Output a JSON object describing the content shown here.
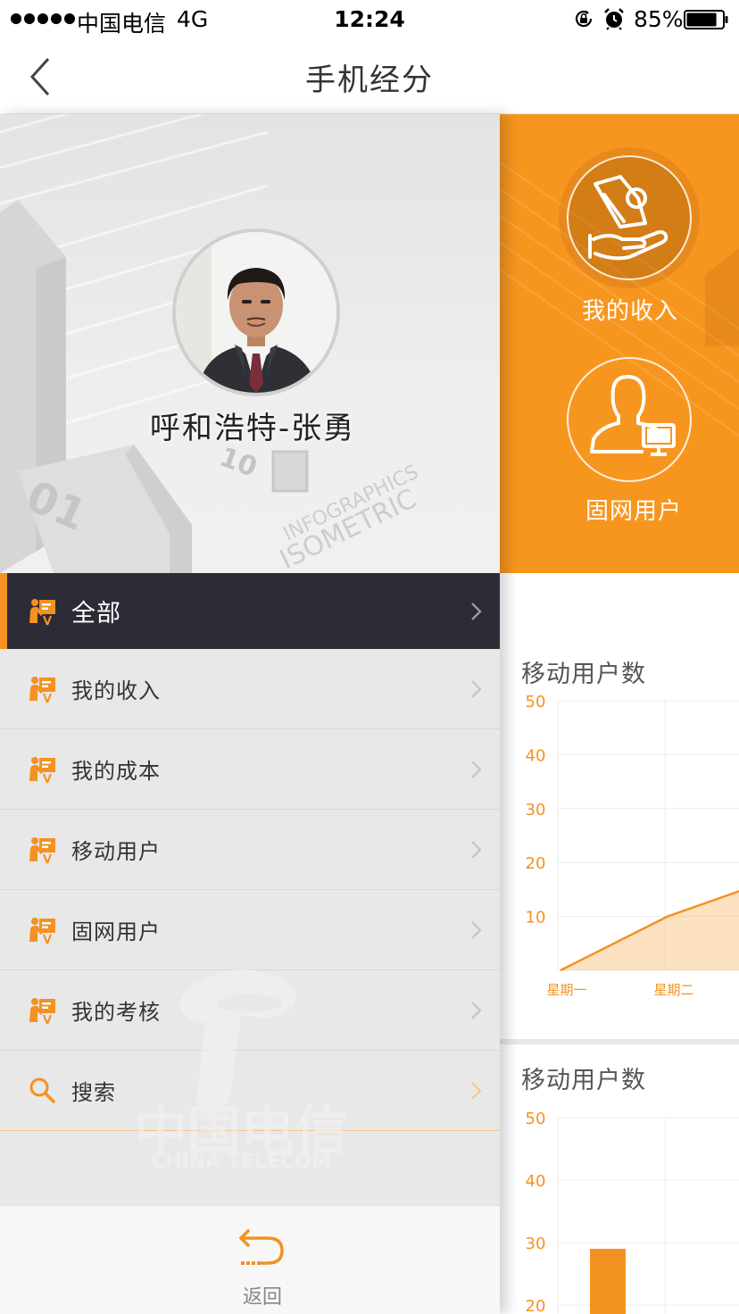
{
  "status_bar": {
    "carrier": "中国电信",
    "network": "4G",
    "time": "12:24",
    "battery": "85%",
    "battery_level": 0.85
  },
  "nav": {
    "title": "手机经分",
    "back_icon": "chevron-left-icon"
  },
  "profile": {
    "name": "呼和浩特-张勇",
    "background_text": [
      "01",
      "10",
      "INFOGRAPHICS",
      "ISOMETRIC"
    ]
  },
  "menu": {
    "items": [
      {
        "label": "全部",
        "icon": "presenter-icon",
        "active": true
      },
      {
        "label": "我的收入",
        "icon": "presenter-icon"
      },
      {
        "label": "我的成本",
        "icon": "presenter-icon"
      },
      {
        "label": "移动用户",
        "icon": "presenter-icon"
      },
      {
        "label": "固网用户",
        "icon": "presenter-icon"
      },
      {
        "label": "我的考核",
        "icon": "presenter-icon"
      },
      {
        "label": "搜索",
        "icon": "search-icon"
      }
    ]
  },
  "watermark": {
    "brand_cn": "中国电信",
    "brand_en": "CHINA TELECOM"
  },
  "bottom_bar": {
    "return_label": "返回"
  },
  "shortcuts": [
    {
      "label": "我的收入",
      "icon": "money-hand-icon"
    },
    {
      "label": "固网用户",
      "icon": "user-computer-icon"
    }
  ],
  "colors": {
    "accent": "#f7961f",
    "drawer_active": "#2c2b36",
    "drawer_bg": "#e8e8e8"
  },
  "chart_data": [
    {
      "type": "area",
      "title": "移动用户数",
      "categories": [
        "星期一",
        "星期二"
      ],
      "yticks": [
        10,
        20,
        30,
        40,
        50
      ],
      "ylim": [
        0,
        50
      ],
      "series": [
        {
          "values": [
            0,
            10,
            17
          ]
        }
      ],
      "grid": true
    },
    {
      "type": "bar",
      "title": "移动用户数",
      "yticks": [
        20,
        30,
        40,
        50
      ],
      "ylim": [
        0,
        50
      ],
      "series": [
        {
          "values": [
            29
          ]
        }
      ],
      "grid": true
    }
  ]
}
